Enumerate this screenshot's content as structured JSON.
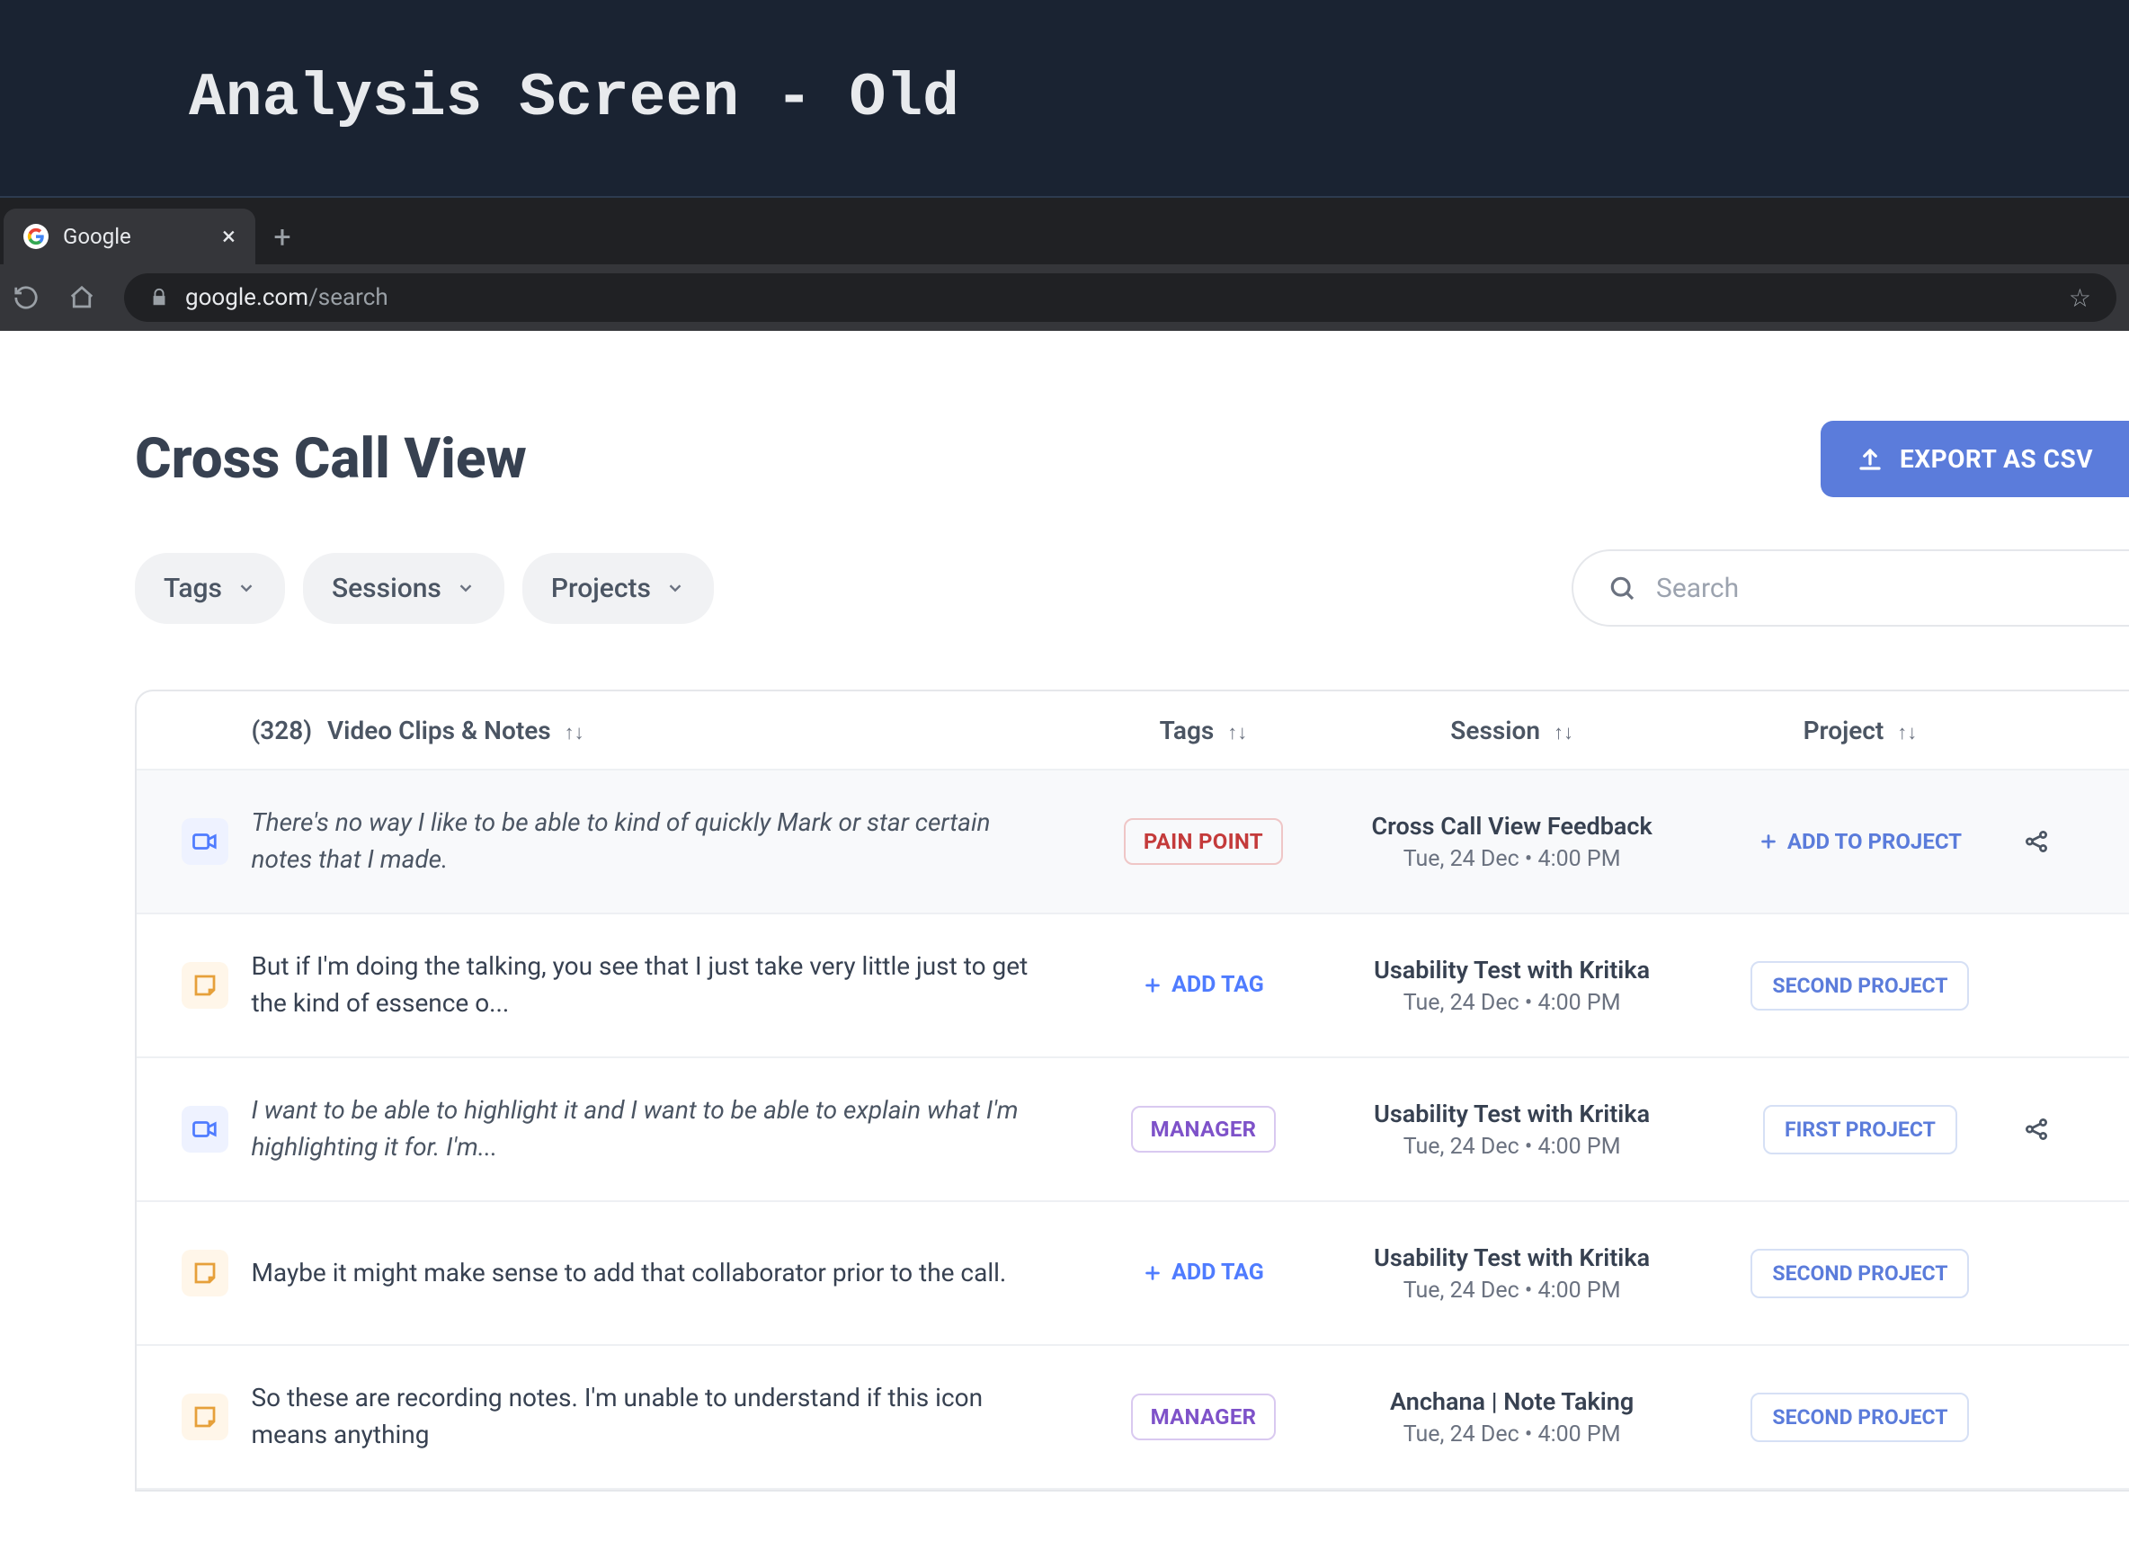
{
  "banner": {
    "title": "Analysis Screen - Old"
  },
  "browser": {
    "tab_title": "Google",
    "url_host": "google.com",
    "url_path": "/search"
  },
  "page": {
    "title": "Cross Call View",
    "export_label": "EXPORT AS CSV"
  },
  "filters": {
    "tags": "Tags",
    "sessions": "Sessions",
    "projects": "Projects",
    "search_placeholder": "Search"
  },
  "table": {
    "count": "(328)",
    "headers": {
      "notes": "Video Clips & Notes",
      "tags": "Tags",
      "session": "Session",
      "project": "Project"
    },
    "add_tag_label": "ADD TAG",
    "add_project_label": "ADD TO PROJECT",
    "rows": [
      {
        "type": "video",
        "italic": true,
        "note": "There's no way I like to be able to kind of quickly Mark or star certain notes that I made.",
        "tag": {
          "label": "PAIN POINT",
          "style": "red"
        },
        "session_title": "Cross Call View Feedback",
        "session_time": "Tue, 24 Dec • 4:00 PM",
        "project_mode": "add",
        "share": true
      },
      {
        "type": "note",
        "italic": false,
        "note": "But if I'm doing the talking, you see that I just take very little just to get the kind of essence o...",
        "tag": null,
        "session_title": "Usability Test with Kritika",
        "session_time": "Tue, 24 Dec • 4:00 PM",
        "project_mode": "pill",
        "project_label": "SECOND PROJECT",
        "share": false
      },
      {
        "type": "video",
        "italic": true,
        "note": "I want to be able to highlight it and I want to be able to explain what I'm highlighting it for. I'm...",
        "tag": {
          "label": "MANAGER",
          "style": "purple"
        },
        "session_title": "Usability Test with Kritika",
        "session_time": "Tue, 24 Dec • 4:00 PM",
        "project_mode": "pill",
        "project_label": "FIRST PROJECT",
        "share": true
      },
      {
        "type": "note",
        "italic": false,
        "note": "Maybe it might make sense to add that collaborator prior to the call.",
        "tag": null,
        "session_title": "Usability Test with Kritika",
        "session_time": "Tue, 24 Dec • 4:00 PM",
        "project_mode": "pill",
        "project_label": "SECOND PROJECT",
        "share": false
      },
      {
        "type": "note",
        "italic": false,
        "note": "So these are recording notes. I'm unable to understand if this icon means anything",
        "tag": {
          "label": "MANAGER",
          "style": "purple"
        },
        "session_title": "Anchana | Note Taking",
        "session_time": "Tue, 24 Dec • 4:00 PM",
        "project_mode": "pill",
        "project_label": "SECOND PROJECT",
        "share": false
      }
    ]
  }
}
